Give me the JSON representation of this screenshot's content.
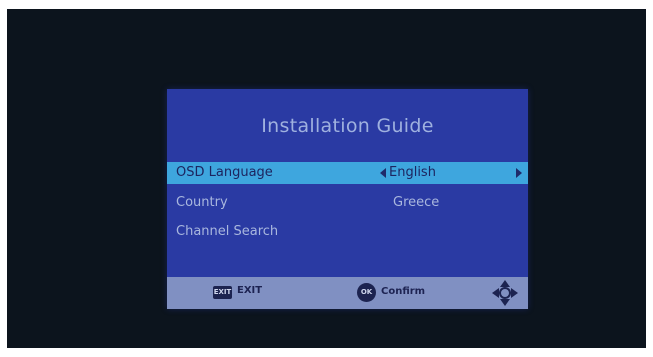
{
  "osd": {
    "title": "Installation Guide",
    "rows": [
      {
        "label": "OSD Language",
        "value": "English",
        "selected": true
      },
      {
        "label": "Country",
        "value": "Greece"
      },
      {
        "label": "Channel Search",
        "value": ""
      }
    ],
    "footer": {
      "exit_key": "EXIT",
      "exit_label": "EXIT",
      "ok_key": "OK",
      "ok_label": "Confirm"
    }
  },
  "colors": {
    "panel": "#2a3aa3",
    "highlight": "#3ea6de",
    "footer": "#8090c2",
    "text": "#a9b7de"
  },
  "icons": [
    "left-arrow-icon",
    "right-arrow-icon",
    "exit-key-icon",
    "ok-key-icon",
    "dpad-icon"
  ]
}
